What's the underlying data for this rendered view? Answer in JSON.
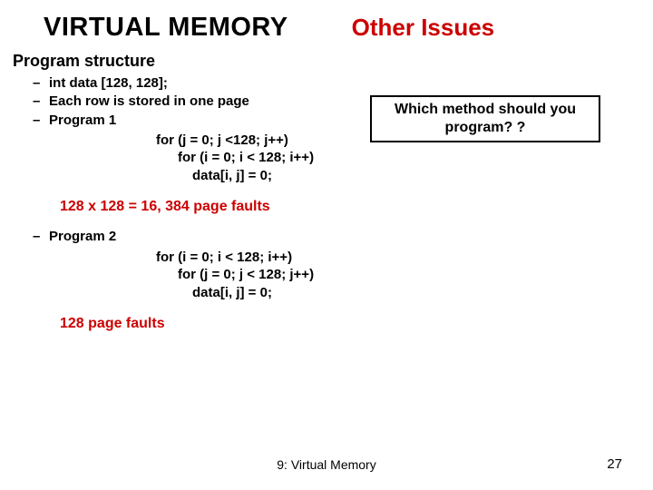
{
  "header": {
    "title_main": "VIRTUAL MEMORY",
    "title_right": "Other Issues"
  },
  "section_heading": "Program structure",
  "bullets": {
    "b1": "int   data [128, 128];",
    "b2": "Each row is stored in one page",
    "b3": "Program 1",
    "b4": "Program 2"
  },
  "question_box": "Which method should you program? ?",
  "program1": {
    "l1": "for (j = 0; j <128; j++)",
    "l2": "for (i = 0; i < 128; i++)",
    "l3": "data[i, j] = 0;",
    "result": "128 x 128 = 16, 384 page faults"
  },
  "program2": {
    "l1": "for (i = 0; i < 128; i++)",
    "l2": "for (j = 0; j < 128; j++)",
    "l3": "data[i, j] = 0;",
    "result": "128 page faults"
  },
  "footer": {
    "center": "9: Virtual Memory",
    "page": "27"
  }
}
